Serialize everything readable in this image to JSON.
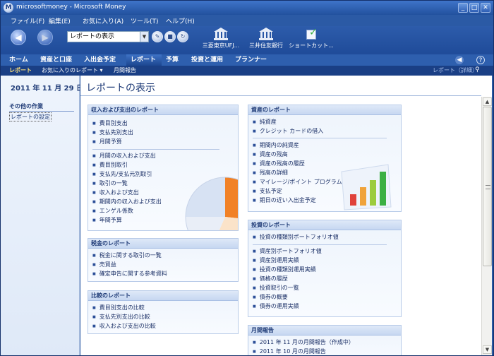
{
  "window": {
    "title": "microsoftmoney - Microsoft Money",
    "app_icon_letter": "M",
    "controls": {
      "minimize": "_",
      "maximize": "□",
      "close": "✕"
    }
  },
  "menu": [
    "ファイル(F)",
    "編集(E)",
    "お気に入り(A)",
    "ツール(T)",
    "ヘルプ(H)"
  ],
  "toolbar": {
    "back_icon": "◀",
    "forward_icon": "▶",
    "address_value": "レポートの表示",
    "dropdown_icon": "▼",
    "round_buttons": [
      "✎",
      "■",
      "↻"
    ],
    "shortcuts": [
      {
        "label": "三菱東京UFJ...",
        "icon": "bank-icon"
      },
      {
        "label": "三井住友銀行",
        "icon": "bank-icon"
      },
      {
        "label": "ショートカット...",
        "icon": "checkbook-icon"
      }
    ]
  },
  "nav_tabs": [
    "ホーム",
    "資産と口座",
    "入出金予定",
    "レポート",
    "予算",
    "投資と運用",
    "プランナー"
  ],
  "nav_active": "レポート",
  "nav_icons": {
    "back": "◀",
    "help": "?"
  },
  "subnav": {
    "items": [
      "レポート",
      "お気に入りのレポート ▾",
      "月間報告"
    ],
    "right_text": "レポート（詳細）",
    "right_icon": "binoculars-icon"
  },
  "left_pane": {
    "date": "2011 年 11 月 29 日",
    "other_tasks_title": "その他の作業",
    "other_tasks_link": "レポートの設定"
  },
  "main": {
    "page_title": "レポートの表示",
    "cards": {
      "income": {
        "title": "収入および支出のレポート",
        "group1": [
          "費目別支出",
          "支払先別支出",
          "月間予算"
        ],
        "group2": [
          "月間の収入および支出",
          "費目別取引",
          "支払先/支払元別取引",
          "取引の一覧",
          "収入および支出",
          "期間内の収入および支出",
          "エンゲル係数",
          "年間予算"
        ]
      },
      "tax": {
        "title": "税金のレポート",
        "items": [
          "税金に関する取引の一覧",
          "売買益",
          "確定申告に関する参考資料"
        ]
      },
      "compare": {
        "title": "比較のレポート",
        "items": [
          "費目別支出の比較",
          "支払先別支出の比較",
          "収入および支出の比較"
        ]
      },
      "assets": {
        "title": "資産のレポート",
        "group1": [
          "純資産",
          "クレジット カードの借入"
        ],
        "group2": [
          "期間内の純資産",
          "資産の残高",
          "資産の残高の履歴",
          "残高の詳細",
          "マイレージ/ポイント プログラム",
          "支払予定",
          "期日の近い入出金予定"
        ]
      },
      "invest": {
        "title": "投資のレポート",
        "group1": [
          "投資の種類別ポートフォリオ値"
        ],
        "group2": [
          "資産別ポートフォリオ値",
          "資産別運用実績",
          "投資の種類別運用実績",
          "価格の履歴",
          "投資取引の一覧",
          "債券の概要",
          "債券の運用実績"
        ]
      },
      "monthly": {
        "title": "月間報告",
        "items": [
          "2011 年 11 月の月間報告（作成中）",
          "2011 年 10 月の月間報告"
        ]
      }
    }
  },
  "scrollbar": {
    "up": "▲",
    "down": "▼"
  },
  "colors": {
    "accent": "#2b5aa5",
    "header": "#1f3b77",
    "pie_orange": "#f07a1a",
    "bar_green": "#3cb043"
  }
}
